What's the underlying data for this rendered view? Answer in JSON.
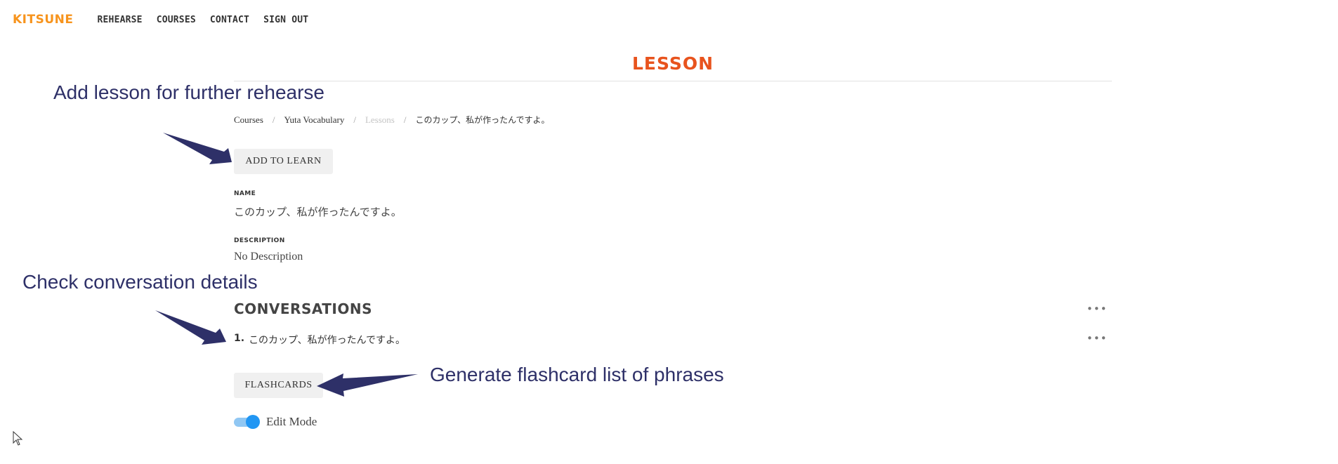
{
  "nav": {
    "logo": "Kitsune",
    "links": [
      "Rehearse",
      "Courses",
      "Contact",
      "Sign out"
    ]
  },
  "page": {
    "title": "Lesson"
  },
  "breadcrumb": {
    "items": [
      "Courses",
      "Yuta Vocabulary",
      "Lessons",
      "このカップ、私が作ったんですよ。"
    ],
    "separator": "/"
  },
  "actions": {
    "add_to_learn": "Add to learn",
    "flashcards": "Flashcards"
  },
  "fields": {
    "name_label": "Name",
    "name_value": "このカップ、私が作ったんですよ。",
    "description_label": "Description",
    "description_value": "No Description"
  },
  "conversations": {
    "title": "Conversations",
    "more_glyph": "•••",
    "items": [
      {
        "number": "1.",
        "text": "このカップ、私が作ったんですよ。"
      }
    ]
  },
  "edit_mode": {
    "label": "Edit Mode",
    "enabled": true
  },
  "annotations": {
    "add_lesson": "Add lesson for further rehearse",
    "check_conversation": "Check conversation details",
    "generate_flashcards": "Generate flashcard list of phrases"
  },
  "colors": {
    "logo": "#f7941d",
    "title": "#e8531d",
    "annotation": "#2e3068",
    "toggle_active": "#2196f3",
    "toggle_track": "#90c7f3",
    "button_bg": "#f0f0f0"
  }
}
